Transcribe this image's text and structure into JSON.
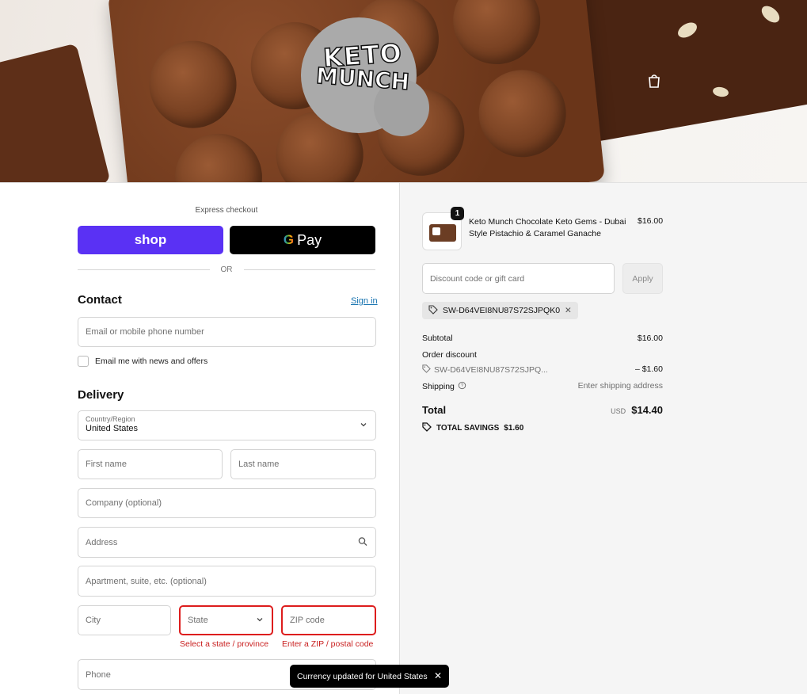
{
  "banner": {
    "logo_line1": "KETO",
    "logo_line2": "MUNCH"
  },
  "express": {
    "label": "Express checkout",
    "shop_label": "shop",
    "gpay_g": "G",
    "gpay_label": "Pay",
    "or_label": "OR"
  },
  "contact": {
    "title": "Contact",
    "signin": "Sign in",
    "email_placeholder": "Email or mobile phone number",
    "newsletter_label": "Email me with news and offers"
  },
  "delivery": {
    "title": "Delivery",
    "country_label": "Country/Region",
    "country_value": "United States",
    "first_name": "First name",
    "last_name": "Last name",
    "company": "Company (optional)",
    "address": "Address",
    "apartment": "Apartment, suite, etc. (optional)",
    "city": "City",
    "state": "State",
    "zip": "ZIP code",
    "state_error": "Select a state / province",
    "zip_error": "Enter a ZIP / postal code",
    "phone": "Phone"
  },
  "toast": {
    "message": "Currency updated for United States"
  },
  "summary": {
    "item": {
      "quantity": "1",
      "name": "Keto Munch Chocolate Keto Gems - Dubai Style Pistachio & Caramel Ganache",
      "price": "$16.00"
    },
    "discount_placeholder": "Discount code or gift card",
    "apply_label": "Apply",
    "applied_code": "SW-D64VEI8NU87S72SJPQK0",
    "subtotal_label": "Subtotal",
    "subtotal_value": "$16.00",
    "order_discount_label": "Order discount",
    "order_discount_code": "SW-D64VEI8NU87S72SJPQ...",
    "order_discount_value": "– $1.60",
    "shipping_label": "Shipping",
    "shipping_value": "Enter shipping address",
    "total_label": "Total",
    "total_currency": "USD",
    "total_value": "$14.40",
    "savings_label": "TOTAL SAVINGS",
    "savings_value": "$1.60"
  },
  "colors": {
    "shop_purple": "#5a31f4",
    "link_blue": "#1773b0",
    "error_red": "#dd1d1d"
  }
}
